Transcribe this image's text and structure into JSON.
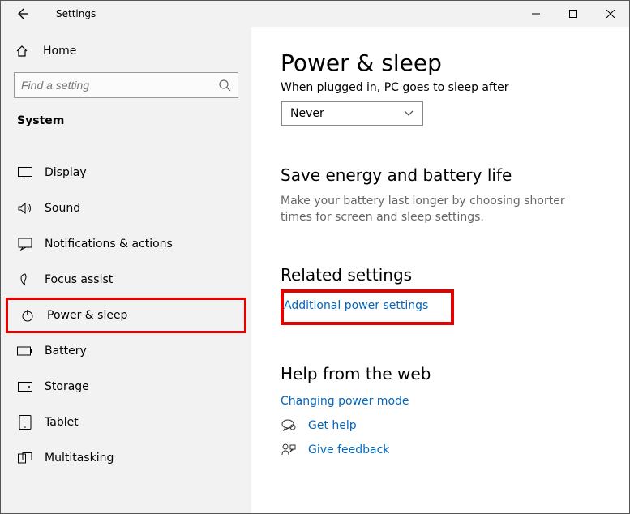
{
  "titlebar": {
    "title": "Settings"
  },
  "sidebar": {
    "home": "Home",
    "search_placeholder": "Find a setting",
    "section": "System",
    "items": [
      {
        "label": "Display"
      },
      {
        "label": "Sound"
      },
      {
        "label": "Notifications & actions"
      },
      {
        "label": "Focus assist"
      },
      {
        "label": "Power & sleep"
      },
      {
        "label": "Battery"
      },
      {
        "label": "Storage"
      },
      {
        "label": "Tablet"
      },
      {
        "label": "Multitasking"
      }
    ]
  },
  "main": {
    "title": "Power & sleep",
    "sleep_label": "When plugged in, PC goes to sleep after",
    "sleep_value": "Never",
    "energy_heading": "Save energy and battery life",
    "energy_desc": "Make your battery last longer by choosing shorter times for screen and sleep settings.",
    "related_heading": "Related settings",
    "related_link": "Additional power settings",
    "help_heading": "Help from the web",
    "help_link": "Changing power mode",
    "get_help": "Get help",
    "feedback": "Give feedback"
  }
}
